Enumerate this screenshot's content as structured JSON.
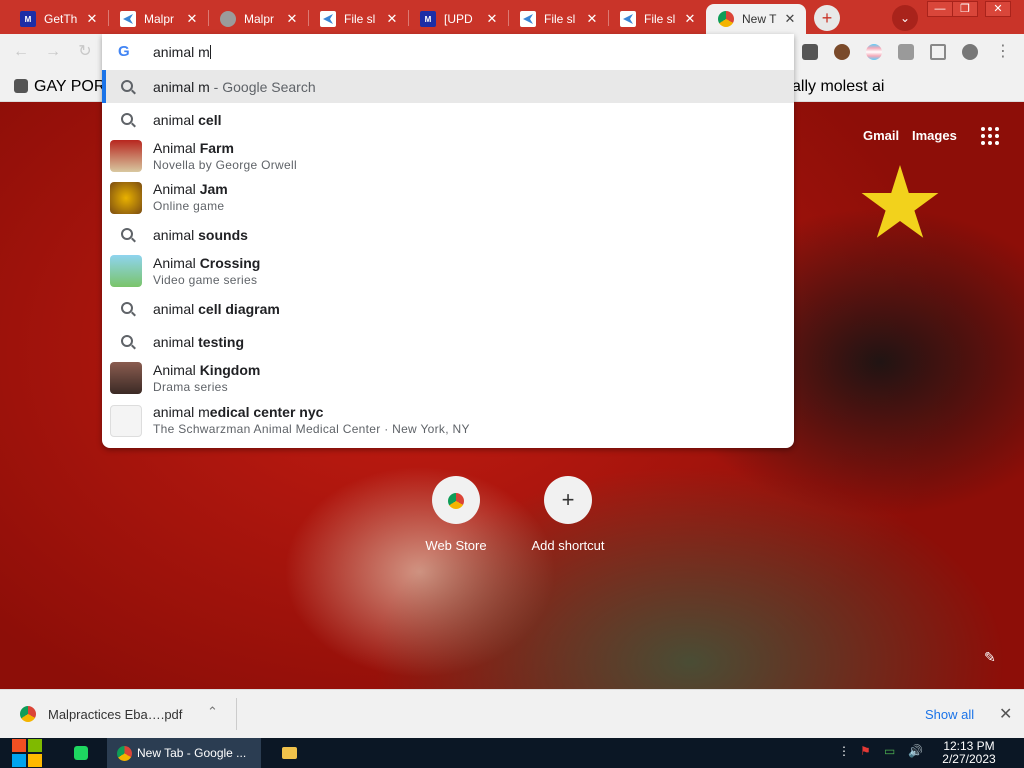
{
  "tabs": [
    {
      "title": "GetTh",
      "favicon": "mft-icon"
    },
    {
      "title": "Malpr",
      "favicon": "blue-arrow-icon"
    },
    {
      "title": "Malpr",
      "favicon": "globe-icon"
    },
    {
      "title": "File sl",
      "favicon": "blue-arrow-icon"
    },
    {
      "title": "[UPD",
      "favicon": "mft-icon"
    },
    {
      "title": "File sl",
      "favicon": "blue-arrow-icon"
    },
    {
      "title": "File sl",
      "favicon": "blue-arrow-icon"
    },
    {
      "title": "New T",
      "favicon": "chrome-icon",
      "active": true
    }
  ],
  "omnibox": {
    "input_value": "animal m",
    "suggestions": [
      {
        "main_normal": "animal m",
        "main_bold": "",
        "suffix": " - Google Search",
        "sub": "",
        "kind": "search"
      },
      {
        "main_normal": "animal ",
        "main_bold": "cell",
        "suffix": "",
        "sub": "",
        "kind": "search"
      },
      {
        "main_normal": "Animal ",
        "main_bold": "Farm",
        "suffix": "",
        "sub": "Novella by George Orwell",
        "kind": "entity"
      },
      {
        "main_normal": "Animal ",
        "main_bold": "Jam",
        "suffix": "",
        "sub": "Online game",
        "kind": "entity"
      },
      {
        "main_normal": "animal ",
        "main_bold": "sounds",
        "suffix": "",
        "sub": "",
        "kind": "search"
      },
      {
        "main_normal": "Animal ",
        "main_bold": "Crossing",
        "suffix": "",
        "sub": "Video game series",
        "kind": "entity"
      },
      {
        "main_normal": "animal ",
        "main_bold": "cell diagram",
        "suffix": "",
        "sub": "",
        "kind": "search"
      },
      {
        "main_normal": "animal ",
        "main_bold": "testing",
        "suffix": "",
        "sub": "",
        "kind": "search"
      },
      {
        "main_normal": "Animal ",
        "main_bold": "Kingdom",
        "suffix": "",
        "sub": "Drama series",
        "kind": "entity"
      },
      {
        "main_normal": "animal m",
        "main_bold": "edical center nyc",
        "suffix": "",
        "sub": "The Schwarzman Animal Medical Center · New York, NY",
        "kind": "entity"
      }
    ]
  },
  "bookmarks": {
    "left": "GAY PORN",
    "right": "ally molest ai"
  },
  "ntp": {
    "gmail": "Gmail",
    "images": "Images",
    "shortcuts": [
      {
        "label": "Web Store",
        "icon": "chrome-web-store-icon"
      },
      {
        "label": "Add shortcut",
        "icon": "plus-icon"
      }
    ]
  },
  "download": {
    "filename": "Malpractices Eba….pdf",
    "show_all": "Show all"
  },
  "taskbar": {
    "chrome_label": "New Tab - Google ...",
    "time": "12:13 PM",
    "date": "2/27/2023"
  },
  "colors": {
    "tab_strip": "#c93429",
    "accent": "#1a73e8",
    "taskbar": "#0b1725"
  }
}
